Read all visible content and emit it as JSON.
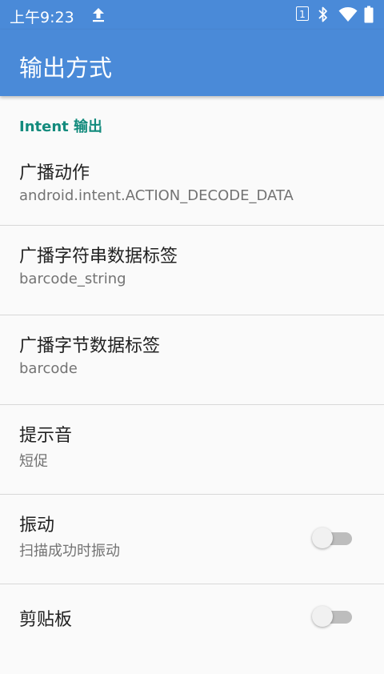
{
  "status_bar": {
    "time": "上午9:23",
    "sim_slot": "1",
    "icons": [
      "upload-icon",
      "sim-icon",
      "bluetooth-icon",
      "wifi-icon",
      "battery-icon"
    ],
    "color": "#4a8ad8"
  },
  "app_bar": {
    "title": "输出方式",
    "color": "#4a8ad8"
  },
  "category": {
    "label": "Intent 输出",
    "color": "#138b7d"
  },
  "preferences": [
    {
      "title": "广播动作",
      "summary": "android.intent.ACTION_DECODE_DATA"
    },
    {
      "title": "广播字符串数据标签",
      "summary": "barcode_string"
    },
    {
      "title": "广播字节数据标签",
      "summary": "barcode"
    },
    {
      "title": "提示音",
      "summary": "短促"
    },
    {
      "title": "振动",
      "summary": "扫描成功时振动",
      "toggle": false
    },
    {
      "title": "剪贴板",
      "toggle": false
    }
  ]
}
